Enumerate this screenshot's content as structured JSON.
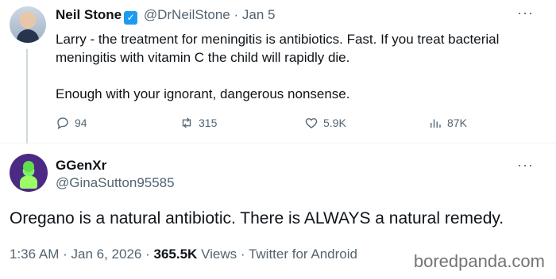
{
  "tweet1": {
    "author_name": "Neil Stone",
    "handle": "@DrNeilStone",
    "separator": "·",
    "date": "Jan 5",
    "more": "···",
    "paragraph1": "Larry -  the treatment for meningitis is antibiotics. Fast. If you treat bacterial meningitis with vitamin C the child will rapidly die.",
    "paragraph2": "Enough with your ignorant, dangerous nonsense.",
    "actions": {
      "replies": "94",
      "retweets": "315",
      "likes": "5.9K",
      "views": "87K"
    }
  },
  "tweet2": {
    "author_name": "GGenXr",
    "handle": "@GinaSutton95585",
    "more": "···",
    "text": "Oregano is a natural antibiotic. There is ALWAYS a natural remedy.",
    "time": "1:36 AM",
    "date": "Jan 6, 2026",
    "views_count": "365.5K",
    "views_label": "Views",
    "source": "Twitter for Android",
    "separator": "·"
  },
  "watermark": "boredpanda.com",
  "colors": {
    "text": "#0f1419",
    "muted": "#536471",
    "verified": "#1d9bf0",
    "divider": "#eff3f4"
  }
}
